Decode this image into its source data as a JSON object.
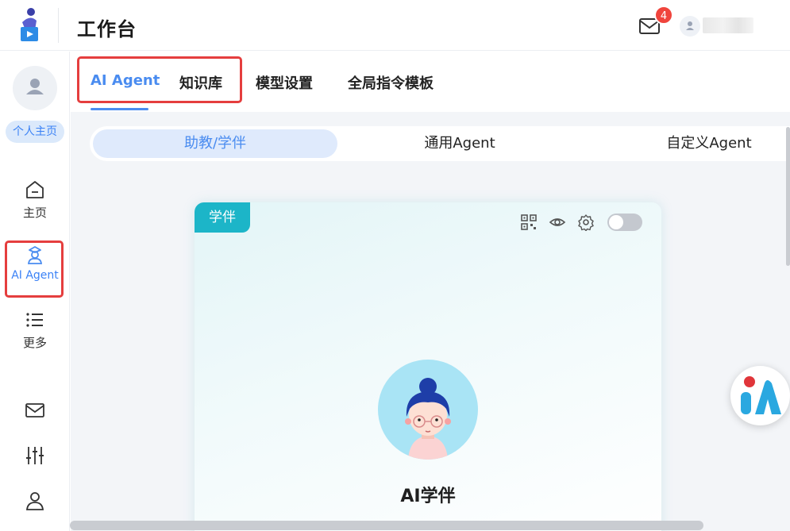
{
  "header": {
    "title": "工作台",
    "mail_badge": "4",
    "logo_icon": "app-logo-icon",
    "mail_icon": "mail-icon",
    "user_icon": "user-icon"
  },
  "sidebar": {
    "personal_home": "个人主页",
    "items": [
      {
        "label": "主页",
        "icon": "home-icon"
      },
      {
        "label": "AI Agent",
        "icon": "ai-agent-icon"
      },
      {
        "label": "更多",
        "icon": "list-icon"
      }
    ],
    "bottom_icons": [
      "mail-icon",
      "sliders-icon",
      "user-icon"
    ]
  },
  "tabs": [
    {
      "label": "AI Agent",
      "active": true
    },
    {
      "label": "知识库",
      "active": false
    },
    {
      "label": "模型设置",
      "active": false
    },
    {
      "label": "全局指令模板",
      "active": false
    }
  ],
  "subtabs": [
    {
      "label": "助教/学伴",
      "active": true
    },
    {
      "label": "通用Agent",
      "active": false
    },
    {
      "label": "自定义Agent",
      "active": false
    }
  ],
  "card": {
    "tag": "学伴",
    "title": "AI学伴",
    "tools": [
      "qr-code-icon",
      "eye-icon",
      "gear-icon"
    ],
    "toggle_on": false
  },
  "colors": {
    "accent": "#4a8cf0",
    "highlight_border": "#e53e3e",
    "tag_bg": "#1cb5c8",
    "badge": "#f0443c"
  }
}
